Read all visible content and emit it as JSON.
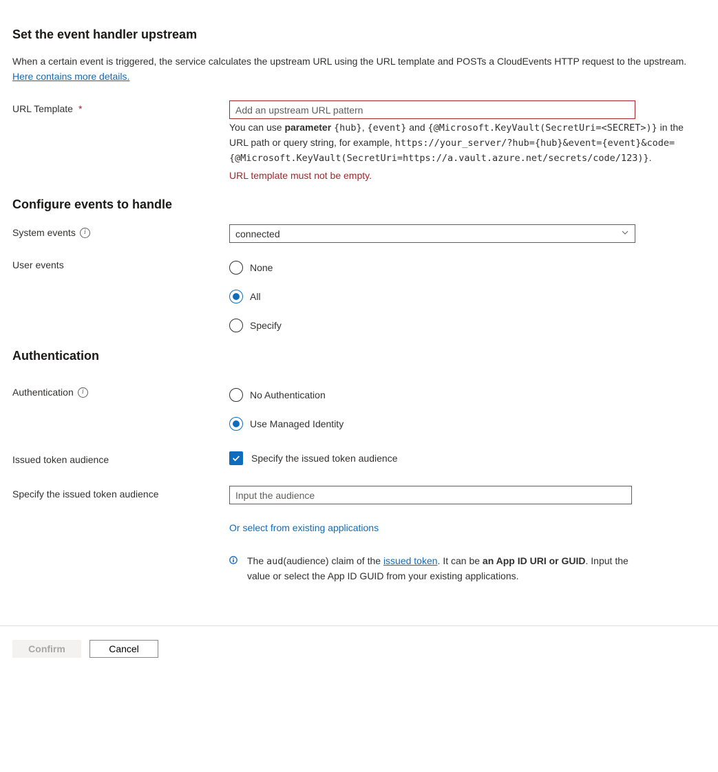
{
  "title_main": "Set the event handler upstream",
  "intro_text": "When a certain event is triggered, the service calculates the upstream URL using the URL template and POSTs a CloudEvents HTTP request to the upstream. ",
  "intro_link": "Here contains more details.",
  "url_template": {
    "label": "URL Template",
    "placeholder": "Add an upstream URL pattern",
    "value": "",
    "help_p1a": "You can use ",
    "help_p1_bold": "parameter",
    "help_p1b": " ",
    "help_p1_code1": "{hub}",
    "help_p1c": ", ",
    "help_p1_code2": "{event}",
    "help_p1d": " and ",
    "help_p1_code3": "{@Microsoft.KeyVault(SecretUri=<SECRET>)}",
    "help_p1e": " in the URL path or query string, for example, ",
    "help_example": "https://your_server/?hub={hub}&event={event}&code={@Microsoft.KeyVault(SecretUri=https://a.vault.azure.net/secrets/code/123)}",
    "help_p1f": ".",
    "error": "URL template must not be empty."
  },
  "title_events": "Configure events to handle",
  "system_events": {
    "label": "System events",
    "selected": "connected"
  },
  "user_events": {
    "label": "User events",
    "options": [
      "None",
      "All",
      "Specify"
    ],
    "selected": "All"
  },
  "title_auth": "Authentication",
  "auth_mode": {
    "label": "Authentication",
    "options": [
      "No Authentication",
      "Use Managed Identity"
    ],
    "selected": "Use Managed Identity"
  },
  "issued_token": {
    "label": "Issued token audience",
    "checkbox_label": "Specify the issued token audience",
    "checked": true
  },
  "specify_audience": {
    "label": "Specify the issued token audience",
    "placeholder": "Input the audience",
    "value": "",
    "select_link": "Or select from existing applications",
    "info_a": "The ",
    "info_code": "aud",
    "info_b": "(audience) claim of the ",
    "info_link": "issued token",
    "info_c": ". It can be ",
    "info_bold": "an App ID URI or GUID",
    "info_d": ". Input the value or select the App ID GUID from your existing applications."
  },
  "footer": {
    "confirm": "Confirm",
    "cancel": "Cancel"
  }
}
